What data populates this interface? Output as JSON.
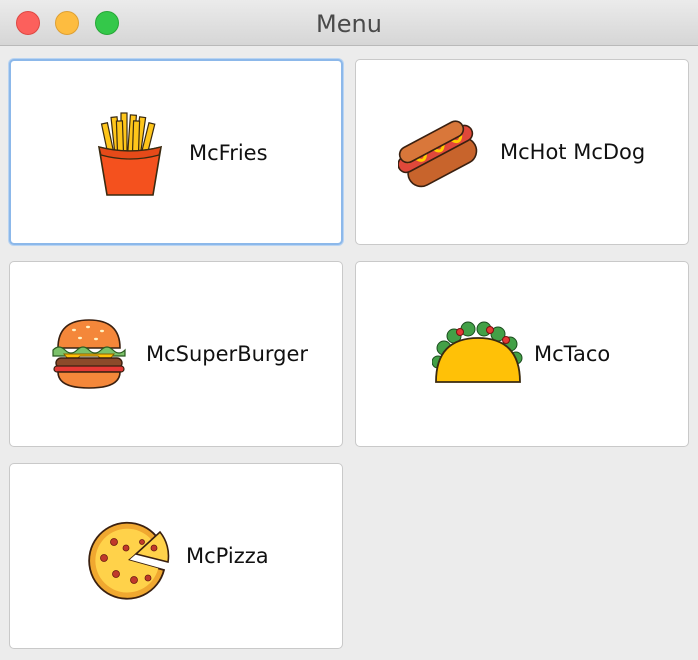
{
  "window": {
    "title": "Menu"
  },
  "menu": {
    "items": [
      {
        "label": "McFries",
        "icon": "fries-icon"
      },
      {
        "label": "McHot McDog",
        "icon": "hotdog-icon"
      },
      {
        "label": "McSuperBurger",
        "icon": "burger-icon"
      },
      {
        "label": "McTaco",
        "icon": "taco-icon"
      },
      {
        "label": "McPizza",
        "icon": "pizza-icon"
      }
    ]
  },
  "colors": {
    "card_background": "#ffffff",
    "window_background": "#ececec",
    "focus_ring": "#8cb8ea",
    "fries": "#f4511e",
    "taco": "#ffc107"
  }
}
